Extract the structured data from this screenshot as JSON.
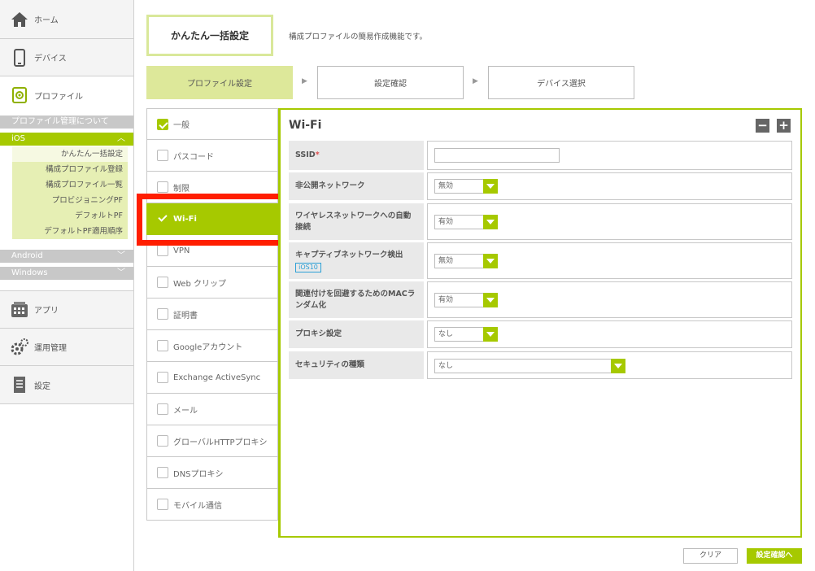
{
  "sidebar": {
    "nav": [
      {
        "label": "ホーム",
        "icon": "home-icon"
      },
      {
        "label": "デバイス",
        "icon": "smartphone-icon"
      },
      {
        "label": "プロファイル",
        "icon": "profile-gear-icon"
      },
      {
        "label": "アプリ",
        "icon": "app-grid-icon"
      },
      {
        "label": "運用管理",
        "icon": "gears-icon"
      },
      {
        "label": "設定",
        "icon": "document-icon"
      }
    ],
    "profile_about": "プロファイル管理について",
    "ios": {
      "label": "iOS",
      "chev": "︿"
    },
    "ios_items": [
      "かんたん一括設定",
      "構成プロファイル登録",
      "構成プロファイル一覧",
      "プロビジョニングPF",
      "デフォルトPF",
      "デフォルトPF適用順序"
    ],
    "android": {
      "label": "Android",
      "chev": "﹀"
    },
    "windows": {
      "label": "Windows",
      "chev": "﹀"
    }
  },
  "header": {
    "title": "かんたん一括設定",
    "description": "構成プロファイルの簡易作成機能です。"
  },
  "steps": [
    "プロファイル設定",
    "設定確認",
    "デバイス選択"
  ],
  "step_arrow": "▶",
  "categories": [
    "一般",
    "パスコード",
    "制限",
    "Wi-Fi",
    "VPN",
    "Web クリップ",
    "証明書",
    "Googleアカウント",
    "Exchange ActiveSync",
    "メール",
    "グローバルHTTPプロキシ",
    "DNSプロキシ",
    "モバイル通信"
  ],
  "panel": {
    "title": "Wi-Fi",
    "minus": "−",
    "plus": "+",
    "rows": [
      {
        "label": "SSID",
        "required": "*",
        "value": ""
      },
      {
        "label": "非公開ネットワーク",
        "value": "無効"
      },
      {
        "label": "ワイヤレスネットワークへの自動接続",
        "value": "有効"
      },
      {
        "label": "キャプティブネットワーク検出",
        "badge": "iOS10",
        "value": "無効"
      },
      {
        "label": "関連付けを回避するためのMACランダム化",
        "value": "有効"
      },
      {
        "label": "プロキシ設定",
        "value": "なし"
      },
      {
        "label": "セキュリティの種類",
        "value": "なし"
      }
    ]
  },
  "footer": {
    "clear": "クリア",
    "confirm": "設定確認へ"
  },
  "colors": {
    "accent": "#a6c900",
    "highlight": "#ff1e00"
  }
}
